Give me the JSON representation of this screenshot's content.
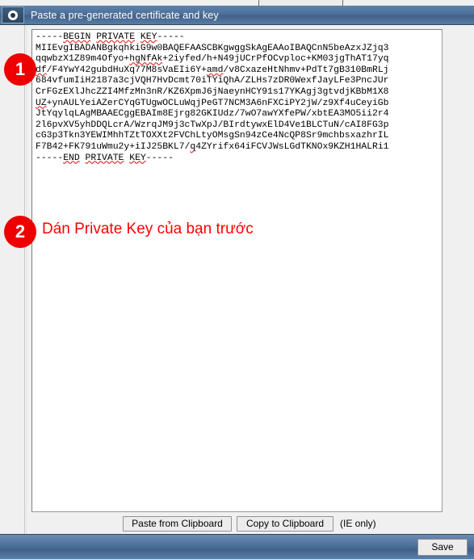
{
  "window": {
    "title": "Paste a pre-generated certificate and key",
    "header_icon": "radio-button-icon"
  },
  "top_strip": {
    "partial_button_label": ""
  },
  "certificate": {
    "label": "private-key-textarea",
    "begin_marker": "-----BEGIN PRIVATE KEY-----",
    "end_marker": "-----END PRIVATE KEY-----",
    "body_lines": [
      "-----BEGIN PRIVATE KEY-----",
      "MIIEvgIBADANBgkqhkiG9w0BAQEFAASCBKgwggSkAgEAAoIBAQCnN5beAzxJZjq3",
      "qqwbzX1Z89m4Ofyo+hgNfAk+2iyfed/h+N49jUCrPfOCvploc+KM03jgThAT17yq",
      "df/F4YwY42gubdHuXq77M8sVaEIi6Y+amd/v8CxazeHtNhmv+PdTt7gB310BmRLj",
      "684vfumIiH2187a3cjVQH7HvDcmt70iTYiQhA/ZLHs7zDR0WexfJayLFe3PncJUr",
      "CrFGzEXlJhcZZI4MfzMn3nR/KZ6XpmJ6jNaeynHCY91s17YKAgj3gtvdjKBbM1X8",
      "UZ+ynAULYeiAZerCYqGTUgwOCLuWqjPeGT7NCM3A6nFXCiPY2jW/z9Xf4uCeyiGb",
      "JtYqylqLAgMBAAECggEBAIm8Ejrg82GKIUdz/7wO7awYXfePW/xbtEA3MO5ii2r4",
      "2l6pvXV5yhDDQLcrA/WzrqJM9j3cTwXpJ/BIrdtywxElD4Ve1BLCTuN/cAI8FG3p",
      "cG3p3Tkn3YEWIMhhTZtTOXXt2FVChLtyOMsgSn94zCe4NcQP8Sr9mchbsxazhrIL",
      "F7B42+FK791uWmu2y+iIJ25BKL7/q4ZYrifx64iFCVJWsLGdTKNOx9KZH1HALRi1",
      "-----END PRIVATE KEY-----"
    ],
    "spellcheck_tokens": [
      "BEGIN",
      "PRIVATE",
      "KEY",
      "hgNfAk",
      "df",
      "amd",
      "UZ",
      "q",
      "END"
    ]
  },
  "annotations": [
    {
      "number": "1",
      "text": ""
    },
    {
      "number": "2",
      "text": "Dán Private Key của bạn trước"
    }
  ],
  "buttons": {
    "paste_from_clipboard": "Paste from Clipboard",
    "copy_to_clipboard": "Copy to Clipboard",
    "ie_only_note": "(IE only)",
    "save": "Save"
  },
  "colors": {
    "header_blue": "#4c7099",
    "footer_blue": "#51749e",
    "annotation_red": "#ee0000",
    "annotation_text_red": "#ff0000",
    "panel_gray": "#f0f0f0",
    "spellcheck_red": "#e03232"
  }
}
